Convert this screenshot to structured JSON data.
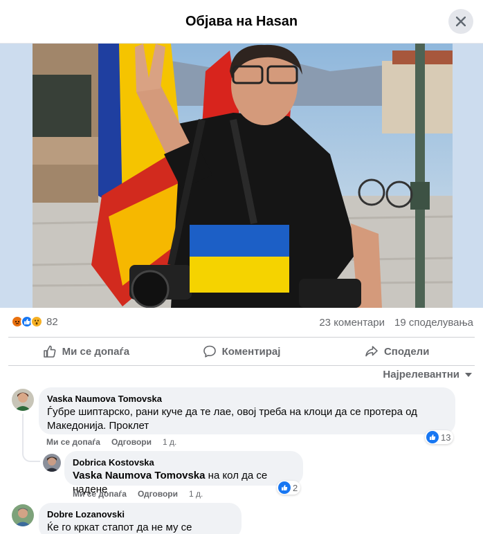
{
  "header": {
    "title": "Објава на Hasan"
  },
  "post": {
    "reaction_icons": [
      "angry-reaction",
      "like-reaction",
      "wow-reaction"
    ],
    "reaction_count": "82",
    "comments_count": "23 коментари",
    "shares_count": "19 споделувања"
  },
  "actions": {
    "like": "Ми се допаѓа",
    "comment": "Коментирај",
    "share": "Сподели"
  },
  "sort": {
    "label": "Најрелевантни"
  },
  "comments": [
    {
      "name": "Vaska Naumova Tomovska",
      "text": "Ѓубре шиптарско, рани куче да те лае, овој треба на клоци да се протера од Македонија. Проклет",
      "like_label": "Ми се допаѓа",
      "reply_label": "Одговори",
      "time": "1 д.",
      "likes": "13"
    },
    {
      "name": "Dobrica Kostovska",
      "mention": "Vaska Naumova Tomovska",
      "text": "на кол да се надене",
      "like_label": "Ми се допаѓа",
      "reply_label": "Одговори",
      "time": "1 д.",
      "likes": "2"
    },
    {
      "name": "Dobre Lozanovski",
      "text": "Ќе го кркат стапот да не му се секираш"
    }
  ],
  "colors": {
    "accent": "#1877f2",
    "text_secondary": "#65676b",
    "bubble": "#f0f2f5"
  }
}
